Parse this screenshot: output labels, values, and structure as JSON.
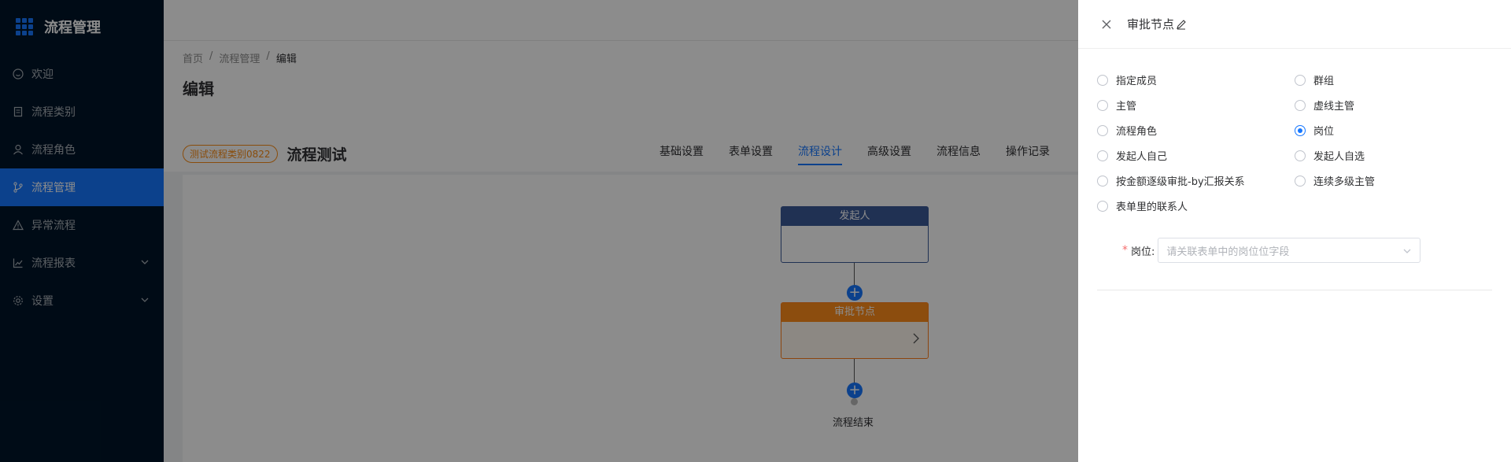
{
  "app": {
    "title": "流程管理"
  },
  "sidebar": {
    "items": [
      {
        "label": "欢迎",
        "icon": "smile-icon"
      },
      {
        "label": "流程类别",
        "icon": "book-icon"
      },
      {
        "label": "流程角色",
        "icon": "user-icon"
      },
      {
        "label": "流程管理",
        "icon": "branch-icon",
        "active": true
      },
      {
        "label": "异常流程",
        "icon": "warning-icon"
      },
      {
        "label": "流程报表",
        "icon": "chart-icon"
      },
      {
        "label": "设置",
        "icon": "gear-icon"
      }
    ]
  },
  "breadcrumb": {
    "home": "首页",
    "sep": "/",
    "section": "流程管理",
    "current": "编辑"
  },
  "page": {
    "title": "编辑"
  },
  "flow": {
    "category_tag": "测试流程类别0822",
    "name": "流程测试",
    "tabs": [
      "基础设置",
      "表单设置",
      "流程设计",
      "高级设置",
      "流程信息",
      "操作记录"
    ],
    "active_tab": "流程设计",
    "nodes": {
      "start": "发起人",
      "approval": "审批节点",
      "end": "流程结束"
    }
  },
  "drawer": {
    "title": "审批节点",
    "radios": {
      "left": [
        "指定成员",
        "主管",
        "流程角色",
        "发起人自己",
        "按金额逐级审批-by汇报关系",
        "表单里的联系人"
      ],
      "right": [
        "群组",
        "虚线主管",
        "岗位",
        "发起人自选",
        "连续多级主管"
      ]
    },
    "selected": "岗位",
    "form": {
      "required_mark": "*",
      "label": "岗位:",
      "placeholder": "请关联表单中的岗位位字段"
    }
  },
  "colors": {
    "sidebar_bg": "#001529",
    "primary": "#1677ff",
    "approval": "#ff8c1a",
    "start": "#3b5998"
  }
}
